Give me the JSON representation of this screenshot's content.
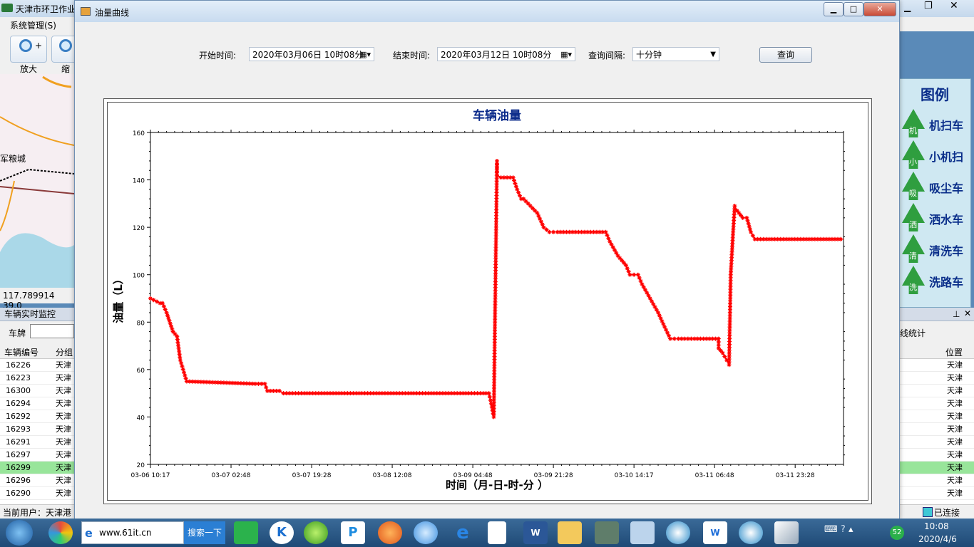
{
  "app": {
    "title": "天津市环卫作业",
    "menu_system": "系统管理(S)",
    "tool_zoom_in": "放大",
    "tool_zoom_out": "缩",
    "map_place": "军粮城",
    "coords": "117.789914  39.0",
    "monitor_title": "车辆实时监控",
    "plate_label": "车牌",
    "columns": [
      "车辆编号",
      "分组"
    ],
    "rows": [
      {
        "id": "16226",
        "group": "天津"
      },
      {
        "id": "16223",
        "group": "天津"
      },
      {
        "id": "16300",
        "group": "天津"
      },
      {
        "id": "16294",
        "group": "天津"
      },
      {
        "id": "16292",
        "group": "天津"
      },
      {
        "id": "16293",
        "group": "天津"
      },
      {
        "id": "16291",
        "group": "天津"
      },
      {
        "id": "16297",
        "group": "天津"
      },
      {
        "id": "16299",
        "group": "天津"
      },
      {
        "id": "16296",
        "group": "天津"
      },
      {
        "id": "16290",
        "group": "天津"
      }
    ],
    "right_col_header": "位置",
    "right_col_value": "天津",
    "right_tab_label": "线统计",
    "current_user": "当前用户：天津港",
    "connected": "已连接"
  },
  "legend": {
    "title": "图例",
    "items": [
      {
        "char": "机",
        "label": "机扫车"
      },
      {
        "char": "小",
        "label": "小机扫"
      },
      {
        "char": "吸",
        "label": "吸尘车"
      },
      {
        "char": "洒",
        "label": "洒水车"
      },
      {
        "char": "清",
        "label": "清洗车"
      },
      {
        "char": "洗",
        "label": "洗路车"
      }
    ]
  },
  "dialog": {
    "title": "油量曲线",
    "start_label": "开始时间:",
    "start_value": "2020年03月06日  10时08分",
    "end_label": "结束时间:",
    "end_value": "2020年03月12日  10时08分",
    "interval_label": "查询间隔:",
    "interval_value": "十分钟",
    "query_button": "查询"
  },
  "taskbar": {
    "address": "www.61it.cn",
    "search": "搜索一下",
    "clock_time": "10:08",
    "clock_date": "2020/4/6",
    "badge": "52"
  },
  "chart_data": {
    "type": "line",
    "title": "车辆油量",
    "xlabel": "时间（月-日-时-分 ）",
    "ylabel": "油量（L）",
    "ylim": [
      20,
      160
    ],
    "yticks": [
      20,
      40,
      60,
      80,
      100,
      120,
      140,
      160
    ],
    "xticks": [
      "03-06 10:17",
      "03-07 02:48",
      "03-07 19:28",
      "03-08 12:08",
      "03-09 04:48",
      "03-09 21:28",
      "03-10 14:17",
      "03-11 06:48",
      "03-11 23:28"
    ],
    "xlim": [
      0,
      8.6
    ],
    "series": [
      {
        "color": "#ff0000",
        "x": [
          0,
          0.12,
          0.15,
          0.2,
          0.28,
          0.33,
          0.37,
          0.45,
          1.3,
          1.42,
          1.45,
          1.6,
          1.65,
          1.8,
          4.2,
          4.22,
          4.26,
          4.3,
          4.3,
          4.35,
          4.5,
          4.55,
          4.6,
          4.63,
          4.8,
          4.88,
          4.95,
          5.0,
          5.05,
          5.65,
          5.7,
          5.8,
          5.9,
          5.95,
          6.05,
          6.1,
          6.2,
          6.3,
          6.38,
          6.45,
          6.55,
          6.75,
          7.05,
          7.05,
          7.1,
          7.15,
          7.18,
          7.2,
          7.23,
          7.25,
          7.28,
          7.35,
          7.4,
          7.45,
          7.5,
          8.6
        ],
        "y": [
          90,
          88,
          88,
          84,
          76,
          74,
          64,
          55,
          54,
          54,
          51,
          51,
          50,
          50,
          50,
          47,
          40,
          148,
          142,
          141,
          141,
          136,
          132,
          132,
          126,
          120,
          118,
          118,
          118,
          118,
          114,
          108,
          104,
          100,
          100,
          96,
          90,
          84,
          78,
          73,
          73,
          73,
          73,
          69,
          67,
          64,
          62,
          100,
          118,
          129,
          127,
          124,
          124,
          118,
          115,
          115
        ]
      }
    ]
  }
}
